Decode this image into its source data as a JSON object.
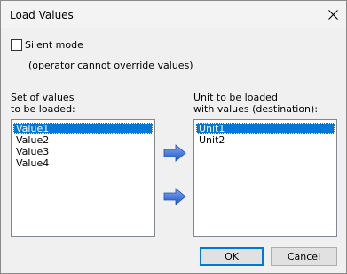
{
  "window": {
    "title": "Load Values"
  },
  "silent_mode": {
    "label": "Silent mode",
    "checked": false,
    "note": "(operator cannot override values)"
  },
  "source": {
    "caption_line1": "Set of values",
    "caption_line2": "to be loaded:",
    "items": [
      "Value1",
      "Value2",
      "Value3",
      "Value4"
    ],
    "selected": "Value1"
  },
  "destination": {
    "caption_line1": "Unit to be loaded",
    "caption_line2": "with values (destination):",
    "items": [
      "Unit1",
      "Unit2"
    ],
    "selected": "Unit1"
  },
  "arrow_icon": "arrow-right-icon",
  "buttons": {
    "ok": "OK",
    "cancel": "Cancel"
  },
  "colors": {
    "selection": "#0078d7",
    "arrow": "#2e6fd6",
    "default_button_border": "#0078d7"
  }
}
